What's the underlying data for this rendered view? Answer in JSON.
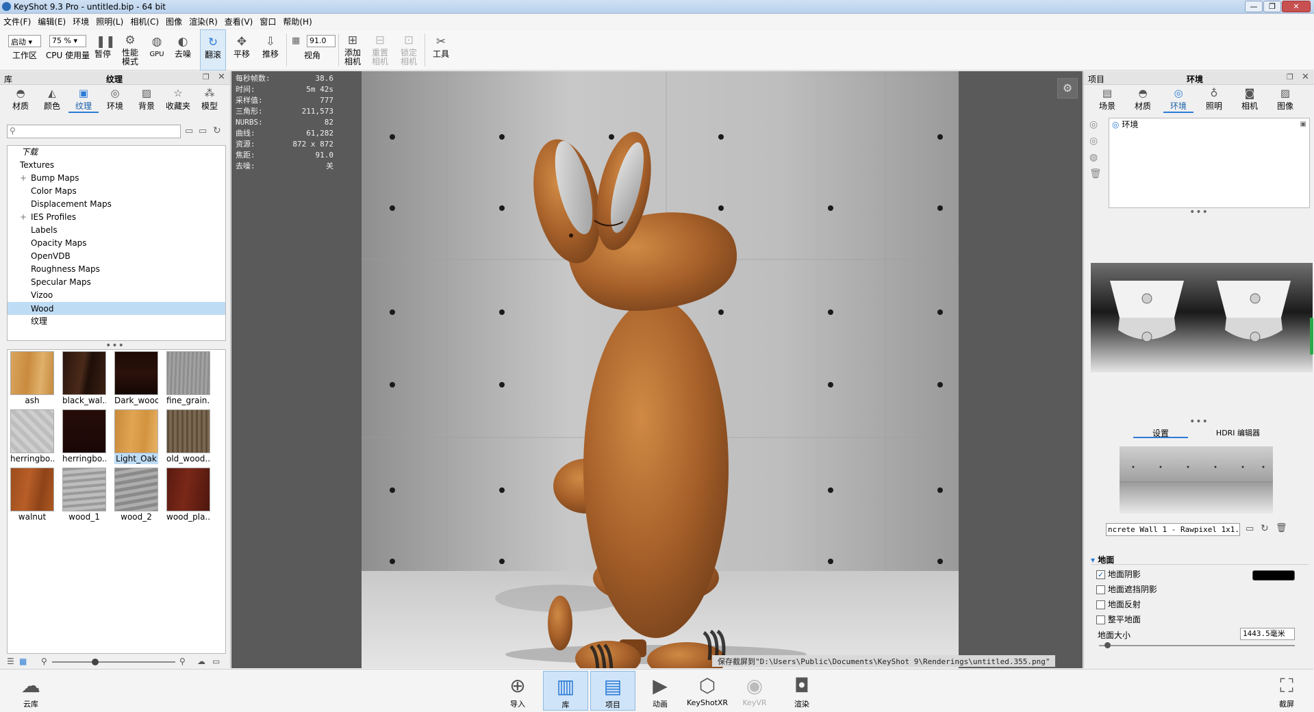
{
  "window": {
    "title": "KeyShot 9.3 Pro  - untitled.bip  - 64 bit"
  },
  "menu": [
    "文件(F)",
    "编辑(E)",
    "环境",
    "照明(L)",
    "相机(C)",
    "图像",
    "渲染(R)",
    "查看(V)",
    "窗口",
    "帮助(H)"
  ],
  "toolbar": {
    "workspace_value": "启动",
    "workspace_label": "工作区",
    "cpu_value": "75 %",
    "cpu_label": "CPU 使用量",
    "pause": "暂停",
    "perf_label_1": "性能",
    "perf_label_2": "模式",
    "gpu": "GPU",
    "denoise": "去噪",
    "tumble": "翻滚",
    "pan": "平移",
    "dolly": "推移",
    "fov_value": "91.0",
    "fov_label": "视角",
    "add_cam_1": "添加",
    "add_cam_2": "相机",
    "reset_cam_1": "重置",
    "reset_cam_2": "相机",
    "lock_cam_1": "锁定",
    "lock_cam_2": "相机",
    "tools": "工具"
  },
  "library": {
    "panel_label": "库",
    "title": "纹理",
    "tabs": [
      "材质",
      "颜色",
      "纹理",
      "环境",
      "背景",
      "收藏夹",
      "模型"
    ],
    "search_placeholder": "",
    "tree": {
      "download": "下载",
      "root": "Textures",
      "items": [
        "Bump Maps",
        "Color Maps",
        "Displacement Maps",
        "IES Profiles",
        "Labels",
        "Opacity Maps",
        "OpenVDB",
        "Roughness Maps",
        "Specular Maps",
        "Vizoo",
        "Wood",
        "纹理"
      ]
    },
    "thumbnails": [
      "ash",
      "black_wal...",
      "Dark_wood",
      "fine_grain...",
      "herringbo...",
      "herringbo...",
      "Light_Oak",
      "old_wood...",
      "walnut",
      "wood_1",
      "wood_2",
      "wood_pla..."
    ]
  },
  "hud": [
    {
      "label": "每秒帧数:",
      "value": "38.6"
    },
    {
      "label": "时间:",
      "value": "5m 42s"
    },
    {
      "label": "采样值:",
      "value": "777"
    },
    {
      "label": "三角形:",
      "value": "211,573"
    },
    {
      "label": "NURBS:",
      "value": "82"
    },
    {
      "label": "曲线:",
      "value": "61,282"
    },
    {
      "label": "资源:",
      "value": "872 x 872"
    },
    {
      "label": "焦距:",
      "value": "91.0"
    },
    {
      "label": "去噪:",
      "value": "关"
    }
  ],
  "status_message": "保存截屏到\"D:\\Users\\Public\\Documents\\KeyShot 9\\Renderings\\untitled.355.png\"",
  "project": {
    "panel_label": "项目",
    "title": "环境",
    "tabs": [
      "场景",
      "材质",
      "环境",
      "照明",
      "相机",
      "图像"
    ],
    "env_item": "环境",
    "subtabs": [
      "设置",
      "HDRI 编辑器"
    ],
    "hdri_file": "ncrete Wall 1 - Rawpixel 1x1.jpg",
    "ground_section": "地面",
    "ground_options": [
      {
        "label": "地面阴影",
        "checked": true
      },
      {
        "label": "地面遮挡阴影",
        "checked": false
      },
      {
        "label": "地面反射",
        "checked": false
      },
      {
        "label": "整平地面",
        "checked": false
      }
    ],
    "ground_size_label": "地面大小",
    "ground_size_value": "1443.5毫米",
    "ground_shadow_color": "#000000"
  },
  "bottom": {
    "cloud": "云库",
    "import": "导入",
    "library": "库",
    "project": "项目",
    "animation": "动画",
    "keyshotxr": "KeyShotXR",
    "keyvr": "KeyVR",
    "render": "渲染",
    "screenshot": "截屏"
  },
  "colors": {
    "accent": "#2c7bd6",
    "selection": "#bfdcf5"
  }
}
